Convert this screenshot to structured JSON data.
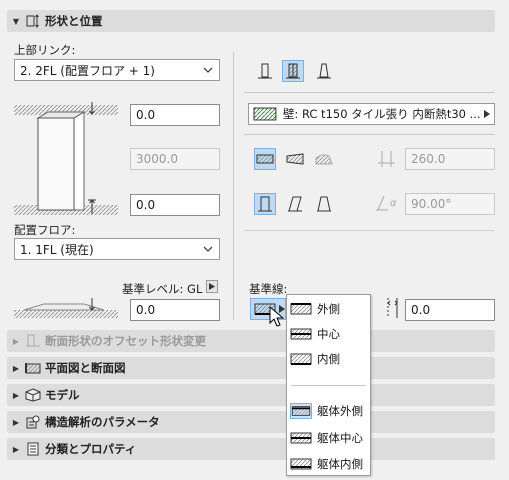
{
  "section_main": {
    "title": "形状と位置"
  },
  "left": {
    "top_link_label": "上部リンク:",
    "top_link_value": "2. 2FL (配置フロア + 1)",
    "top_offset": "0.0",
    "height": "3000.0",
    "bottom_offset": "0.0",
    "home_floor_label": "配置フロア:",
    "home_floor_value": "1. 1FL (現在)",
    "ref_level_label": "基準レベル: GL",
    "ref_level_value": "0.0"
  },
  "right": {
    "composite_value": "壁: RC t150 タイル張り 内断熱t30 ...",
    "thickness": "260.0",
    "angle": "90.00°",
    "angle_symbol": "α",
    "ref_line_label": "基準線:",
    "ref_line_offset": "0.0"
  },
  "ref_line_menu": {
    "items": [
      "外側",
      "中心",
      "内側"
    ],
    "core_items": [
      "躯体外側",
      "躯体中心",
      "躯体内側"
    ]
  },
  "sections": [
    {
      "title": "断面形状のオフセット形状変更",
      "disabled": true
    },
    {
      "title": "平面図と断面図",
      "disabled": false
    },
    {
      "title": "モデル",
      "disabled": false
    },
    {
      "title": "構造解析のパラメータ",
      "disabled": false
    },
    {
      "title": "分類とプロパティ",
      "disabled": false
    }
  ],
  "colors": {
    "selected_bg": "#bfd9f2",
    "selected_border": "#7fb0de",
    "hatch": "#3a8a3a"
  }
}
